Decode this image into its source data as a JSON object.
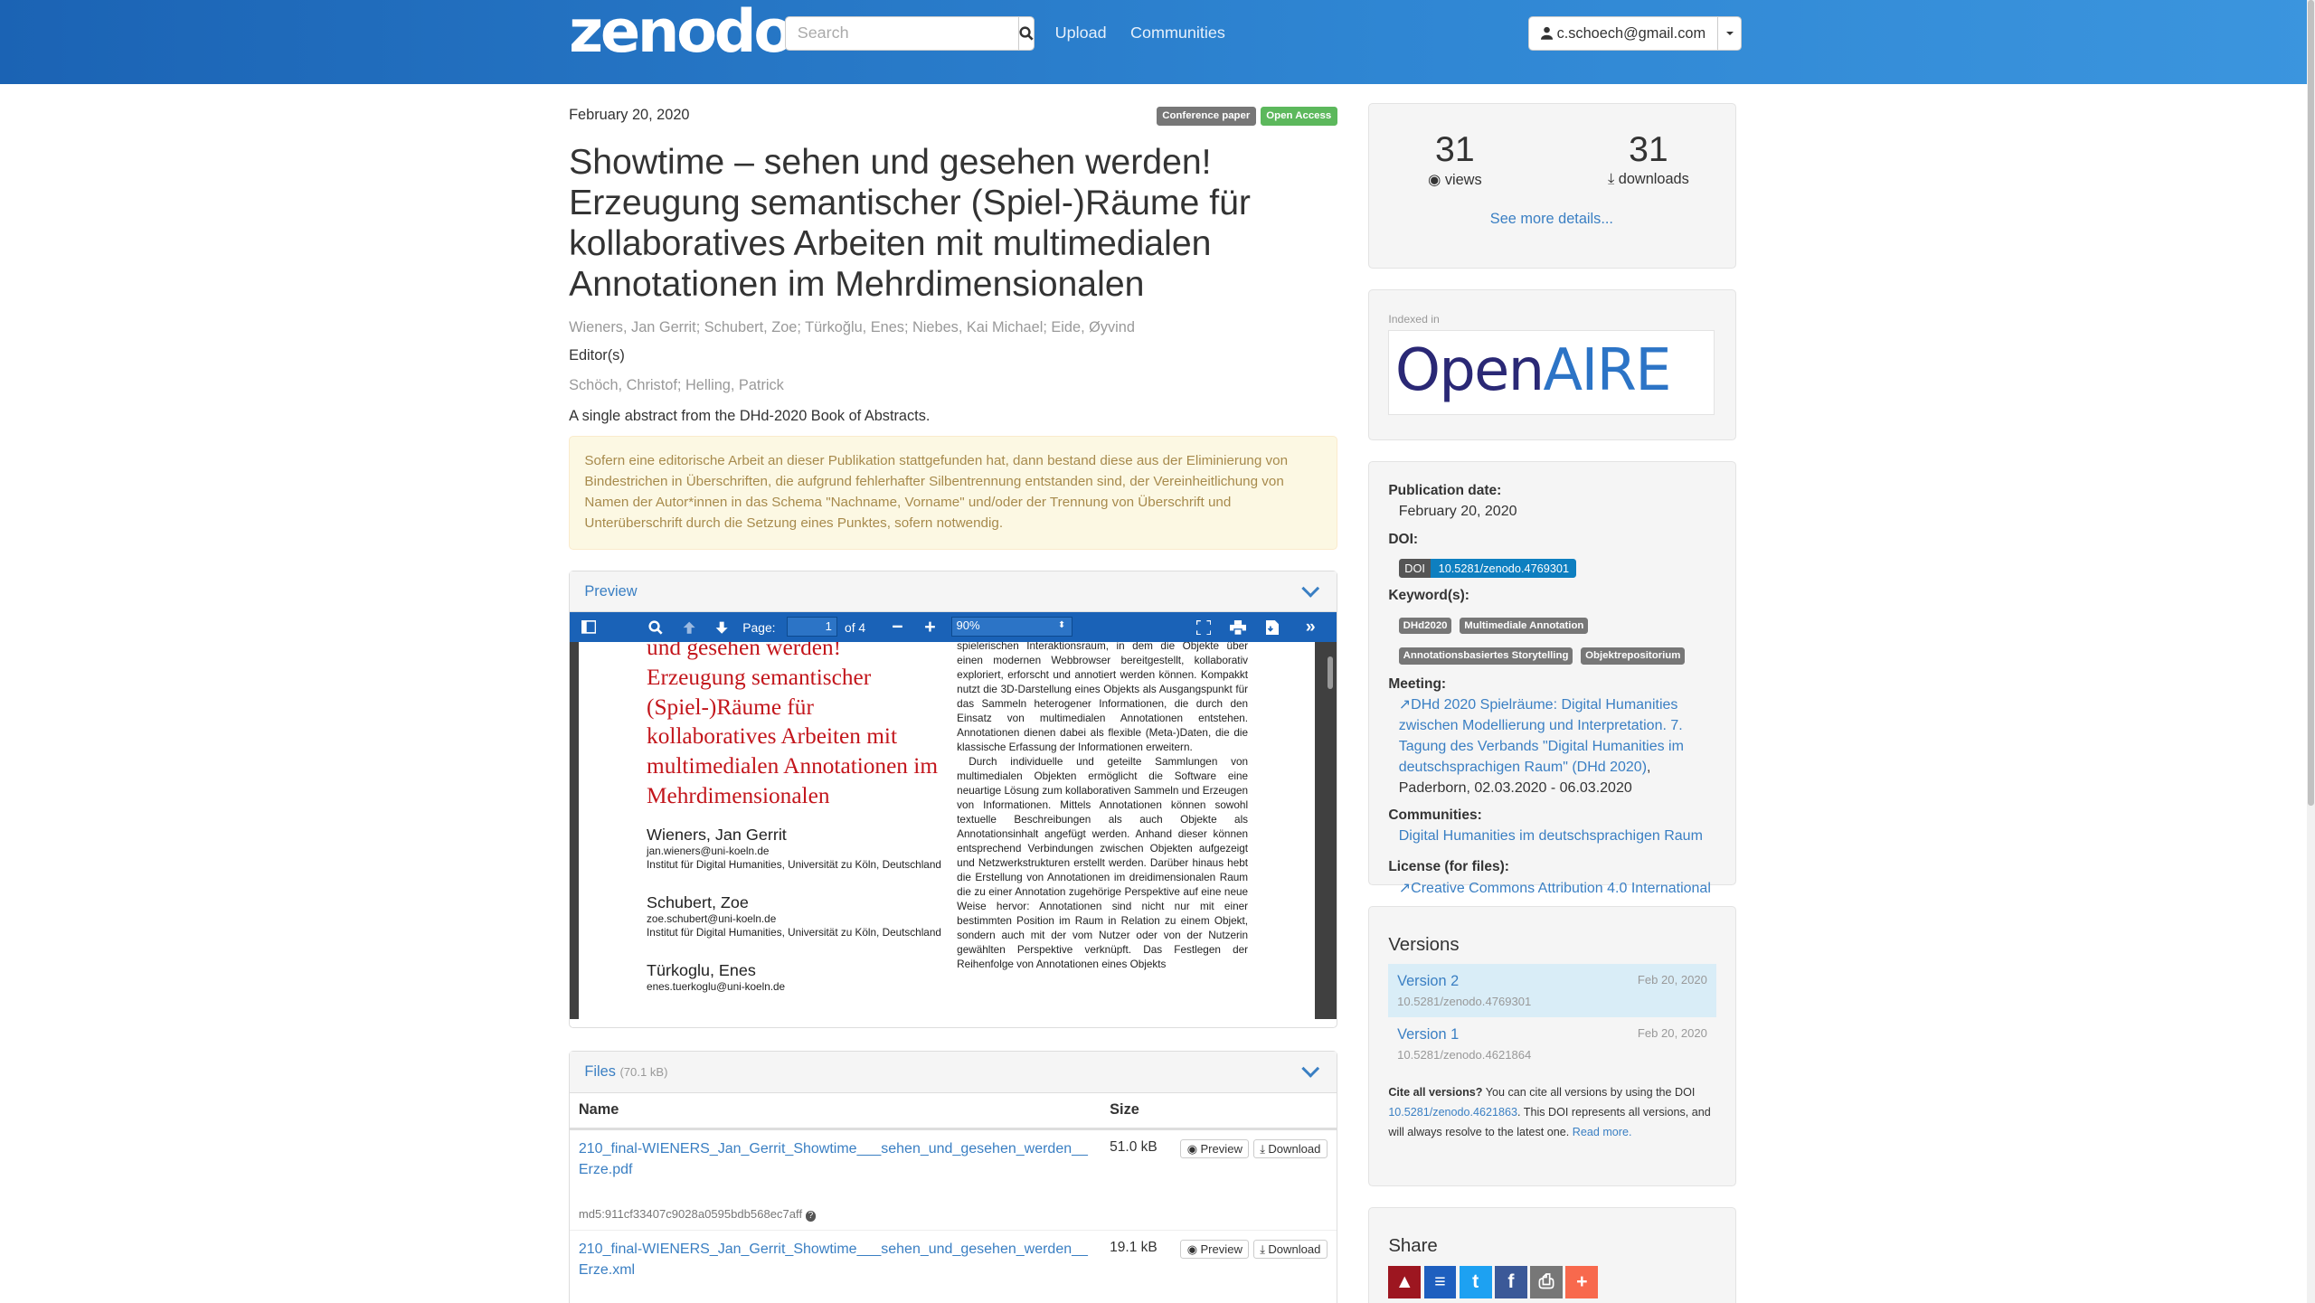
{
  "nav": {
    "logo": "zenodo",
    "search_placeholder": "Search",
    "upload": "Upload",
    "communities": "Communities",
    "user": "c.schoech@gmail.com"
  },
  "record": {
    "date": "February 20, 2020",
    "badges": [
      "Conference paper",
      "Open Access"
    ],
    "title": "Showtime – sehen und gesehen werden! Erzeugung semantischer (Spiel-)Räume für kollaboratives Arbeiten mit multimedialen Annotationen im Mehrdimensionalen",
    "authors": "Wieners, Jan Gerrit; Schubert, Zoe; Türkoğlu, Enes; Niebes, Kai Michael; Eide, Øyvind",
    "editors_heading": "Editor(s)",
    "editors": "Schöch, Christof; Helling, Patrick",
    "description": "A single abstract from the DHd-2020 Book of Abstracts.",
    "notice": "Sofern eine editorische Arbeit an dieser Publikation stattgefunden hat, dann bestand diese aus der Eliminierung von Bindestrichen in Überschriften, die aufgrund fehlerhafter Silbentrennung entstanden sind, der Vereinheitlichung von Namen der Autor*innen in das Schema \"Nachname, Vorname\" und/oder der Trennung von Überschrift und Unterüberschrift durch die Setzung eines Punktes, sofern notwendig."
  },
  "preview": {
    "heading": "Preview",
    "page_label": "Page:",
    "page_value": "1",
    "page_of": "of 4",
    "zoom": "90%",
    "pdf_title_top": "und gesehen werden!",
    "pdf_title": "Erzeugung semantischer (Spiel-)Räume für kollaboratives Arbeiten mit multimedialen Annotationen im Mehrdimensionalen",
    "pdf_authors": [
      {
        "name": "Wieners, Jan Gerrit",
        "email": "jan.wieners@uni-koeln.de",
        "inst": "Institut für Digital Humanities, Universität zu Köln, Deutschland"
      },
      {
        "name": "Schubert, Zoe",
        "email": "zoe.schubert@uni-koeln.de",
        "inst": "Institut für Digital Humanities, Universität zu Köln, Deutschland"
      },
      {
        "name": "Türkoglu, Enes",
        "email": "enes.tuerkoglu@uni-koeln.de",
        "inst": ""
      }
    ],
    "pdf_col2_p1": "spielerischen Interaktionsraum, in dem die Objekte über einen modernen Webbrowser bereitgestellt, kollaborativ exploriert, erforscht und annotiert werden können. Kompakkt nutzt die 3D-Darstellung eines Objekts als Ausgangspunkt für das Sammeln heterogener Informationen, die durch den Einsatz von multimedialen Annotationen entstehen. Annotationen dienen dabei als flexible (Meta-)Daten, die die klassische Erfassung der Informationen erweitern.",
    "pdf_col2_p2": "Durch individuelle und geteilte Sammlungen von multimedialen Objekten ermöglicht die Software eine neuartige Lösung zum kollaborativen Sammeln und Erzeugen von Informationen. Mittels Annotationen können sowohl textuelle Beschreibungen als auch Objekte als Annotationsinhalt angefügt werden. Anhand dieser können entsprechend Verbindungen zwischen Objekten aufgezeigt und Netzwerkstrukturen erstellt werden. Darüber hinaus hebt die Erstellung von Annotationen im dreidimensionalen Raum die zu einer Annotation zugehörige Perspektive auf eine neue Weise hervor: Annotationen sind nicht nur mit einer bestimmten Position im Raum in Relation zu einem Objekt, sondern auch mit der vom Nutzer oder von der Nutzerin gewählten Perspektive verknüpft. Das Festlegen der Reihenfolge von Annotationen eines Objekts"
  },
  "files": {
    "heading": "Files",
    "size_total": "(70.1 kB)",
    "col_name": "Name",
    "col_size": "Size",
    "preview_btn": "Preview",
    "download_btn": "Download",
    "rows": [
      {
        "name": "210_final-WIENERS_Jan_Gerrit_Showtime___sehen_und_gesehen_werden__Erze.pdf",
        "size": "51.0 kB",
        "md5": "md5:911cf33407c9028a0595bdb568ec7aff"
      },
      {
        "name": "210_final-WIENERS_Jan_Gerrit_Showtime___sehen_und_gesehen_werden__Erze.xml",
        "size": "19.1 kB",
        "md5": ""
      }
    ]
  },
  "stats": {
    "views": "31",
    "views_label": "views",
    "downloads": "31",
    "downloads_label": "downloads",
    "more": "See more details..."
  },
  "indexed": {
    "label": "Indexed in",
    "logo_open": "Open",
    "logo_aire": "AIRE"
  },
  "meta": {
    "pubdate_h": "Publication date:",
    "pubdate": "February 20, 2020",
    "doi_h": "DOI:",
    "doi_tag": "DOI",
    "doi": "10.5281/zenodo.4769301",
    "keywords_h": "Keyword(s):",
    "keywords": [
      "DHd2020",
      "Multimediale Annotation",
      "Annotationsbasiertes Storytelling",
      "Objektrepositorium"
    ],
    "meeting_h": "Meeting:",
    "meeting_link": "DHd 2020 Spielräume: Digital Humanities zwischen Modellierung und Interpretation. 7. Tagung des Verbands \"Digital Humanities im deutschsprachigen Raum\" (DHd 2020)",
    "meeting_rest": ", Paderborn, 02.03.2020 - 06.03.2020",
    "communities_h": "Communities:",
    "community": "Digital Humanities im deutschsprachigen Raum",
    "license_h": "License (for files):",
    "license": "Creative Commons Attribution 4.0 International"
  },
  "versions": {
    "heading": "Versions",
    "items": [
      {
        "name": "Version 2",
        "doi": "10.5281/zenodo.4769301",
        "date": "Feb 20, 2020"
      },
      {
        "name": "Version 1",
        "doi": "10.5281/zenodo.4621864",
        "date": "Feb 20, 2020"
      }
    ],
    "cite_bold": "Cite all versions?",
    "cite_text1": " You can cite all versions by using the DOI ",
    "cite_doi": "10.5281/zenodo.4621863",
    "cite_text2": ". This DOI represents all versions, and will always resolve to the latest one. ",
    "read_more": "Read more."
  },
  "share": {
    "heading": "Share",
    "icons": [
      "mendeley-icon",
      "citeulike-icon",
      "twitter-icon",
      "facebook-icon",
      "print-icon",
      "addthis-icon"
    ],
    "colors": [
      "#9d1620",
      "#1e5fbf",
      "#1da1f2",
      "#3b5998",
      "#777777",
      "#f8694d"
    ]
  }
}
